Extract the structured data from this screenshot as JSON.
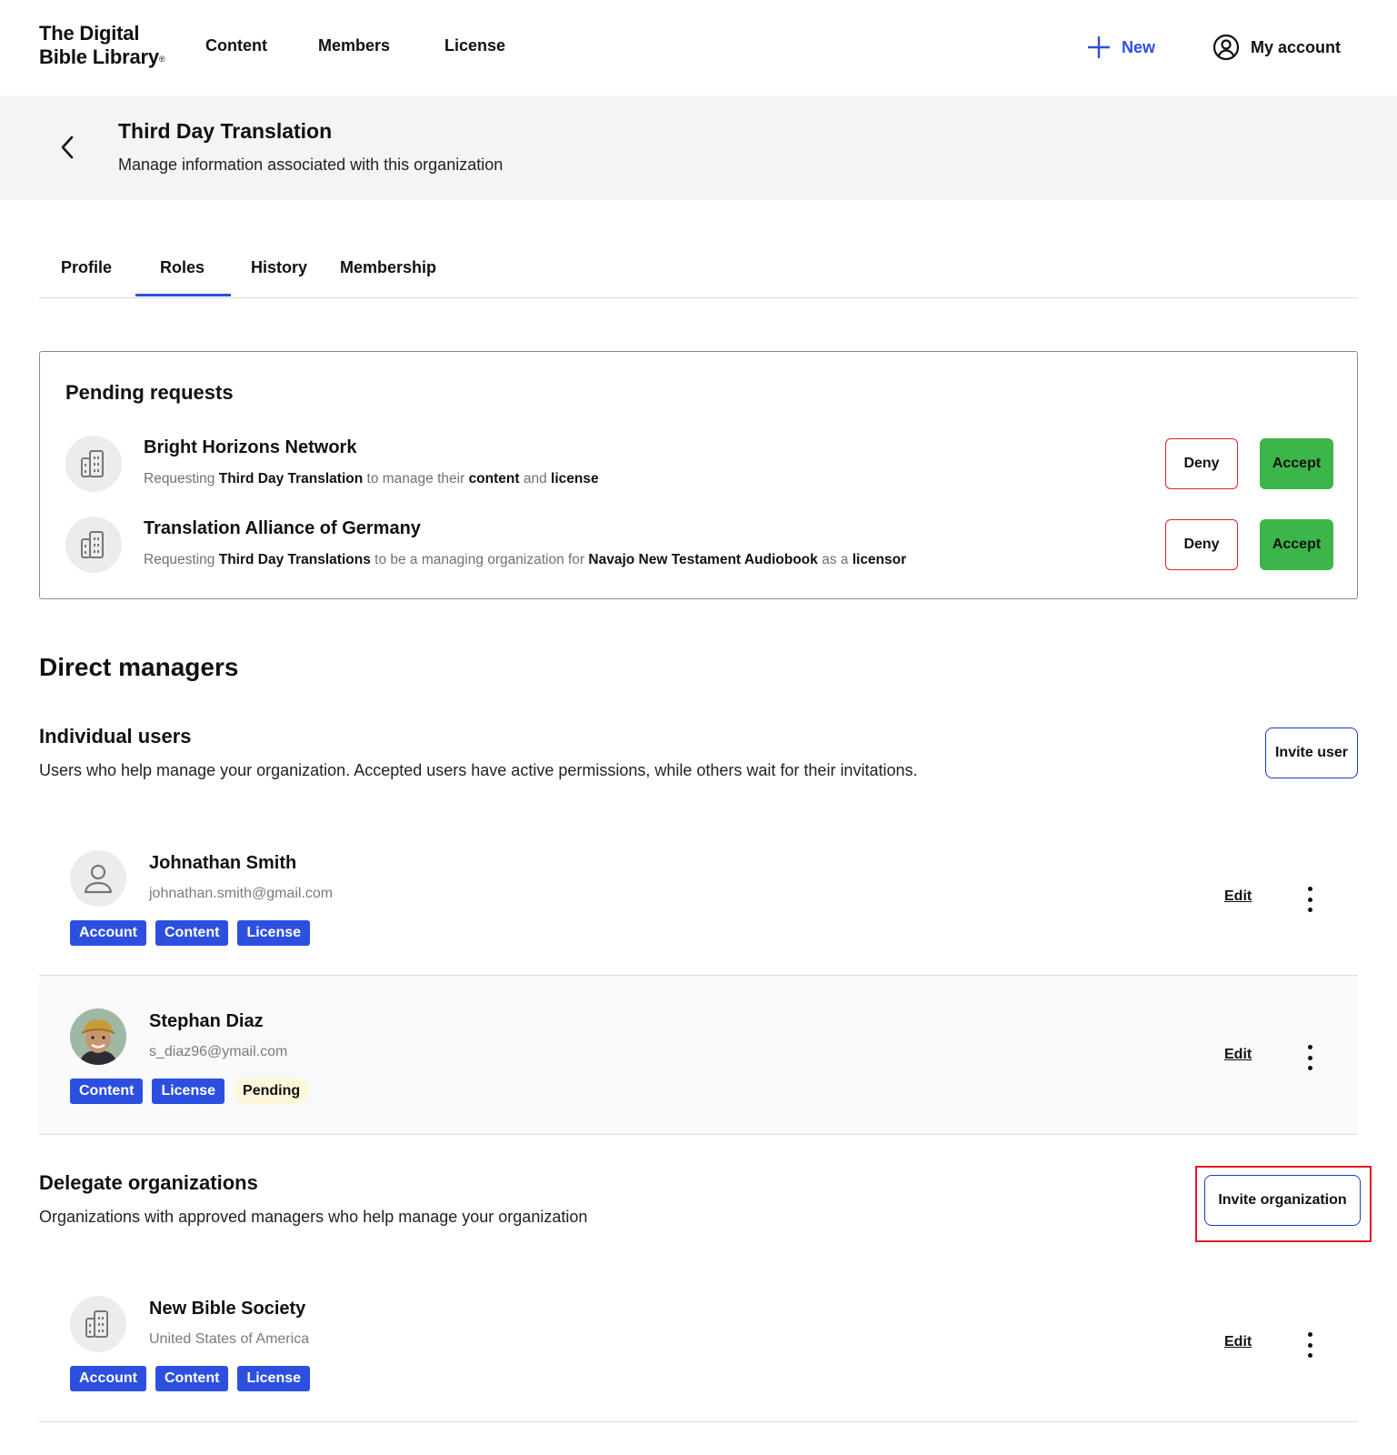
{
  "brand": {
    "line1": "The Digital",
    "line2": "Bible Library",
    "mark": "®"
  },
  "nav": {
    "content": "Content",
    "members": "Members",
    "license": "License",
    "new": "New",
    "account": "My account"
  },
  "header": {
    "title": "Third Day Translation",
    "subtitle": "Manage information associated with this organization"
  },
  "tabs": [
    {
      "label": "Profile"
    },
    {
      "label": "Roles",
      "active": true
    },
    {
      "label": "History"
    },
    {
      "label": "Membership"
    }
  ],
  "pending": {
    "title": "Pending requests",
    "deny_label": "Deny",
    "accept_label": "Accept",
    "requests": [
      {
        "name": "Bright Horizons Network",
        "p1": "Requesting",
        "b1": "Third Day Translation",
        "p2": "to manage their",
        "b2": "content",
        "p3": "and",
        "b3": "license"
      },
      {
        "name": "Translation Alliance of Germany",
        "p1": "Requesting",
        "b1": "Third Day Translations",
        "p2": "to be a managing organization for",
        "b2": "Navajo New Testament Audiobook",
        "p3": "as a",
        "b3": "licensor"
      }
    ]
  },
  "direct_managers": {
    "title": "Direct managers",
    "individual": {
      "title": "Individual users",
      "desc": "Users who help manage your organization. Accepted users have active permissions, while others wait for their invitations.",
      "invite_label": "Invite user",
      "users": [
        {
          "name": "Johnathan Smith",
          "email": "johnathan.smith@gmail.com",
          "badges": [
            "Account",
            "Content",
            "License"
          ],
          "edit": "Edit"
        },
        {
          "name": "Stephan Diaz",
          "email": "s_diaz96@ymail.com",
          "badges": [
            "Content",
            "License"
          ],
          "status": "Pending",
          "edit": "Edit"
        }
      ]
    },
    "delegate": {
      "title": "Delegate organizations",
      "desc": "Organizations with approved managers who help manage your organization",
      "invite_label": "Invite organization",
      "orgs": [
        {
          "name": "New Bible Society",
          "country": "United States of America",
          "badges": [
            "Account",
            "Content",
            "License"
          ],
          "edit": "Edit"
        }
      ]
    }
  },
  "colors": {
    "accent": "#2d4fe0",
    "accept": "#3cb64a",
    "deny_border": "#d72424",
    "pending_badge": "#fdf7d9",
    "highlight": "#e31b23",
    "header_band": "#f3f4f5"
  }
}
